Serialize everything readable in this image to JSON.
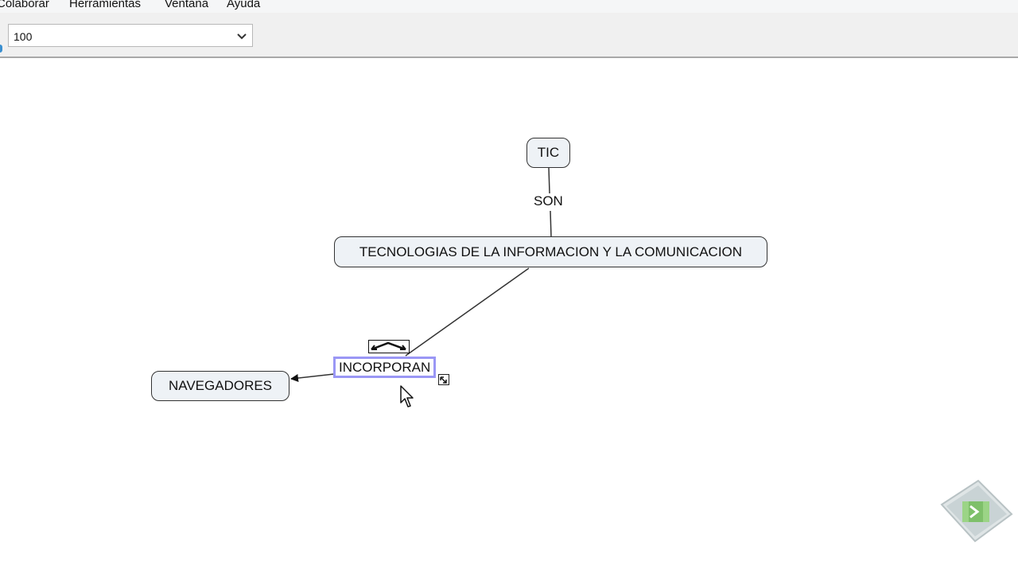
{
  "menubar": {
    "items": [
      {
        "label": "Colaborar"
      },
      {
        "label": "Herramientas"
      },
      {
        "label": "Ventana"
      },
      {
        "label": "Ayuda"
      }
    ]
  },
  "toolbar": {
    "zoom": {
      "value": "100",
      "icon": "chevron-down-icon"
    }
  },
  "concept_map": {
    "concepts": {
      "tic": "TIC",
      "tecnologias": "TECNOLOGIAS DE LA INFORMACION Y LA COMUNICACION",
      "navegadores": "NAVEGADORES"
    },
    "links": {
      "son": "SON",
      "incorporan": "INCORPORAN"
    },
    "selection_color": "#9a97f5"
  }
}
